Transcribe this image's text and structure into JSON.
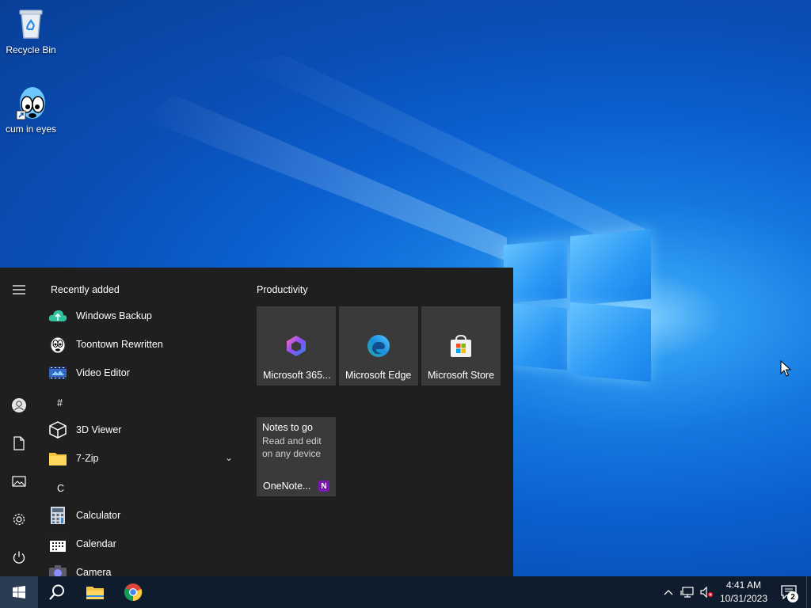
{
  "desktop": {
    "icons": [
      {
        "label": "Recycle Bin",
        "icon": "recycle-bin-icon"
      },
      {
        "label": "cum in eyes",
        "icon": "shortcut-cartoon-eyes-icon"
      }
    ]
  },
  "start_menu": {
    "rail": [
      "hamburger-icon",
      "user-icon",
      "documents-icon",
      "pictures-icon",
      "settings-icon",
      "power-icon"
    ],
    "recently_added_header": "Recently added",
    "recent_apps": [
      {
        "label": "Windows Backup",
        "icon": "windows-backup-icon"
      },
      {
        "label": "Toontown Rewritten",
        "icon": "toontown-icon"
      },
      {
        "label": "Video Editor",
        "icon": "video-editor-icon"
      }
    ],
    "sections": [
      {
        "letter": "#",
        "apps": [
          {
            "label": "3D Viewer",
            "icon": "3d-viewer-icon"
          },
          {
            "label": "7-Zip",
            "icon": "folder-icon",
            "expandable": true
          }
        ]
      },
      {
        "letter": "C",
        "apps": [
          {
            "label": "Calculator",
            "icon": "calculator-icon"
          },
          {
            "label": "Calendar",
            "icon": "calendar-icon"
          },
          {
            "label": "Camera",
            "icon": "camera-icon"
          }
        ]
      }
    ],
    "tiles_group_title": "Productivity",
    "tiles": [
      {
        "label": "Microsoft 365...",
        "icon": "microsoft-365-icon"
      },
      {
        "label": "Microsoft Edge",
        "icon": "edge-icon"
      },
      {
        "label": "Microsoft Store",
        "icon": "store-icon"
      }
    ],
    "onenote_tile": {
      "title": "Notes to go",
      "subtitle": "Read and edit on any device",
      "label": "OneNote...",
      "badge": "N"
    }
  },
  "taskbar": {
    "pinned": [
      "search-icon",
      "file-explorer-icon",
      "chrome-icon"
    ],
    "tray": {
      "time": "4:41 AM",
      "date": "10/31/2023",
      "notification_count": "2"
    }
  },
  "colors": {
    "start_bg": "#1f1f1f",
    "tile_bg": "#3a3a3a",
    "taskbar_bg": "#0f1c2e"
  }
}
